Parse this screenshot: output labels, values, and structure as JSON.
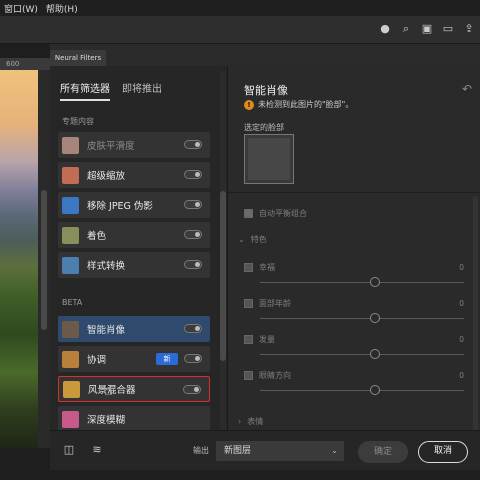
{
  "menubar": {
    "items": [
      "窗口(W)",
      "帮助(H)"
    ]
  },
  "appbar": {
    "icons": [
      "user-icon",
      "search-icon",
      "frame-icon",
      "layout-icon",
      "share-icon"
    ]
  },
  "ruler": {
    "value": "600"
  },
  "panel_tab": "Neural Filters",
  "filters": {
    "tabs": [
      "所有筛选器",
      "即将推出"
    ],
    "section_featured": "专题内容",
    "section_beta": "BETA",
    "items": [
      {
        "label": "皮肤平滑度",
        "enabled": false
      },
      {
        "label": "超级缩放",
        "enabled": true
      },
      {
        "label": "移除 JPEG 伪影",
        "enabled": true
      },
      {
        "label": "着色",
        "enabled": true
      },
      {
        "label": "样式转换",
        "enabled": true
      },
      {
        "label": "智能肖像",
        "enabled": true,
        "selected": true
      },
      {
        "label": "协调",
        "enabled": true,
        "badge": "新"
      },
      {
        "label": "风景混合器",
        "enabled": true,
        "highlight": true
      },
      {
        "label": "深度模糊",
        "enabled": true
      }
    ]
  },
  "settings": {
    "title": "智能肖像",
    "warning": "未检测到此图片的\"脸部\"。",
    "face_label": "选定的脸部",
    "auto_balance": "自动平衡组合",
    "expression_section": "特色",
    "sliders": [
      {
        "label": "幸福",
        "value": "0"
      },
      {
        "label": "面部年龄",
        "value": "0"
      },
      {
        "label": "发量",
        "value": "0"
      },
      {
        "label": "眼睛方向",
        "value": "0"
      }
    ],
    "sub_section": "表情"
  },
  "bottom": {
    "output_label": "输出",
    "output_value": "新图层",
    "ok_label": "确定",
    "cancel_label": "取消"
  },
  "colors": {
    "accent": "#2c6ad6",
    "highlight_border": "#d8302b",
    "selected_bg": "#2f4a6c",
    "warning": "#e08a1e"
  }
}
